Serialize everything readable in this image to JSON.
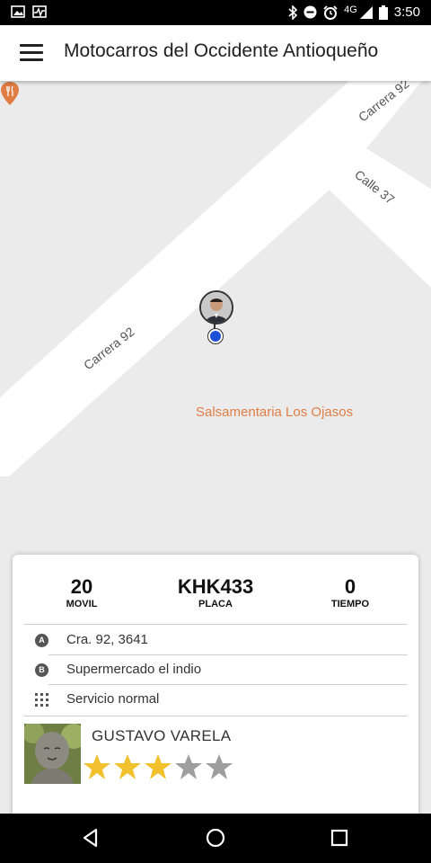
{
  "status_bar": {
    "time": "3:50",
    "network": "4G",
    "icons_left": [
      "image-icon",
      "activity-icon"
    ],
    "icons_right": [
      "bluetooth-icon",
      "do-not-disturb-icon",
      "alarm-icon",
      "signal-icon",
      "battery-icon"
    ]
  },
  "app_bar": {
    "title": "Motocarros del Occidente Antioqueño",
    "menu_icon": "hamburger-menu-icon"
  },
  "map": {
    "streets": [
      "Carrera 92",
      "Calle 37",
      "Carrera 92"
    ],
    "poi_name": "Salsamentaria Los Ojasos",
    "poi_icon": "restaurant-icon",
    "poi_color": "#e07d44",
    "location_color": "#1a4fd6"
  },
  "trip": {
    "stats": [
      {
        "value": "20",
        "label": "MOVIL"
      },
      {
        "value": "KHK433",
        "label": "PLACA"
      },
      {
        "value": "0",
        "label": "TIEMPO"
      }
    ],
    "origin_marker": "A",
    "origin": "Cra. 92, 3641",
    "destination_marker": "B",
    "destination": "Supermercado el indio",
    "service_type": "Servicio normal"
  },
  "driver": {
    "name": "GUSTAVO VARELA",
    "rating": 3,
    "max_rating": 5,
    "star_color": "#f2c12e"
  }
}
